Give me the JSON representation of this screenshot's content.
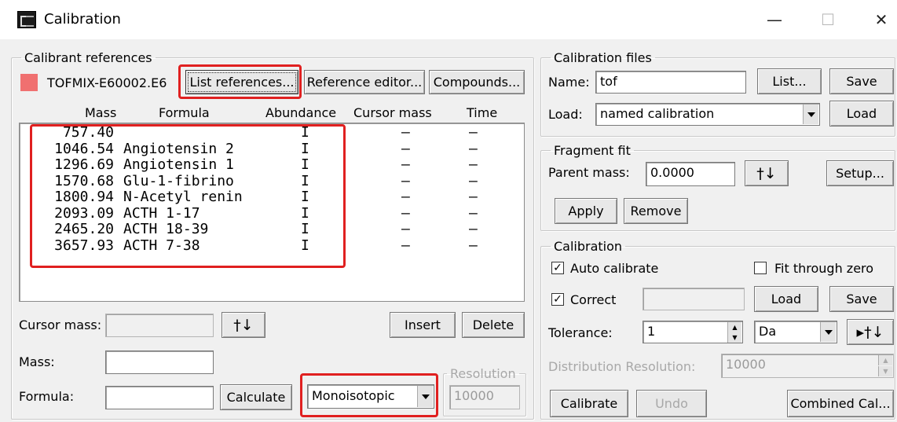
{
  "window": {
    "title": "Calibration",
    "minimize": "—",
    "maximize": "☐",
    "close": "✕"
  },
  "calibrant_references": {
    "legend": "Calibrant references",
    "color": "#f07070",
    "file": "TOFMIX-E60002.E6",
    "list_references": "List references...",
    "reference_editor": "Reference editor...",
    "compounds": "Compounds...",
    "columns": [
      "Mass",
      "Formula",
      "Abundance",
      "Cursor mass",
      "Time"
    ],
    "rows": [
      {
        "mass": "757.40",
        "formula": "",
        "abundance": "I",
        "cursor_mass": "–",
        "time": "–"
      },
      {
        "mass": "1046.54",
        "formula": "Angiotensin 2",
        "abundance": "I",
        "cursor_mass": "–",
        "time": "–"
      },
      {
        "mass": "1296.69",
        "formula": "Angiotensin 1",
        "abundance": "I",
        "cursor_mass": "–",
        "time": "–"
      },
      {
        "mass": "1570.68",
        "formula": "Glu-1-fibrino",
        "abundance": "I",
        "cursor_mass": "–",
        "time": "–"
      },
      {
        "mass": "1800.94",
        "formula": "N-Acetyl renin",
        "abundance": "I",
        "cursor_mass": "–",
        "time": "–"
      },
      {
        "mass": "2093.09",
        "formula": "ACTH 1-17",
        "abundance": "I",
        "cursor_mass": "–",
        "time": "–"
      },
      {
        "mass": "2465.20",
        "formula": "ACTH 18-39",
        "abundance": "I",
        "cursor_mass": "–",
        "time": "–"
      },
      {
        "mass": "3657.93",
        "formula": "ACTH 7-38",
        "abundance": "I",
        "cursor_mass": "–",
        "time": "–"
      }
    ],
    "cursor_mass_label": "Cursor mass:",
    "cursor_mass_value": "",
    "insert": "Insert",
    "delete": "Delete",
    "mass_label": "Mass:",
    "mass_value": "",
    "formula_label": "Formula:",
    "formula_value": "",
    "calculate": "Calculate",
    "isotope_mode": "Monoisotopic",
    "resolution_legend": "Resolution",
    "resolution_value": "10000",
    "arrows_icon": "†↓"
  },
  "calibration_files": {
    "legend": "Calibration files",
    "name_label": "Name:",
    "name_value": "tof",
    "list": "List...",
    "save": "Save",
    "load_label": "Load:",
    "load_value": "named calibration",
    "load": "Load"
  },
  "fragment_fit": {
    "legend": "Fragment fit",
    "parent_mass_label": "Parent mass:",
    "parent_mass_value": "0.0000",
    "setup": "Setup...",
    "apply": "Apply",
    "remove": "Remove"
  },
  "calibration": {
    "legend": "Calibration",
    "auto_calibrate": "Auto calibrate",
    "auto_calibrate_checked": true,
    "fit_through_zero": "Fit through zero",
    "fit_through_zero_checked": false,
    "correct": "Correct",
    "correct_checked": true,
    "correct_value": "",
    "load": "Load",
    "save": "Save",
    "tolerance_label": "Tolerance:",
    "tolerance_value": "1",
    "tolerance_unit": "Da",
    "distribution_resolution_label": "Distribution Resolution:",
    "distribution_resolution_value": "10000",
    "calibrate": "Calibrate",
    "undo": "Undo",
    "combined": "Combined Cal..."
  },
  "highlight_color": "#e02020"
}
